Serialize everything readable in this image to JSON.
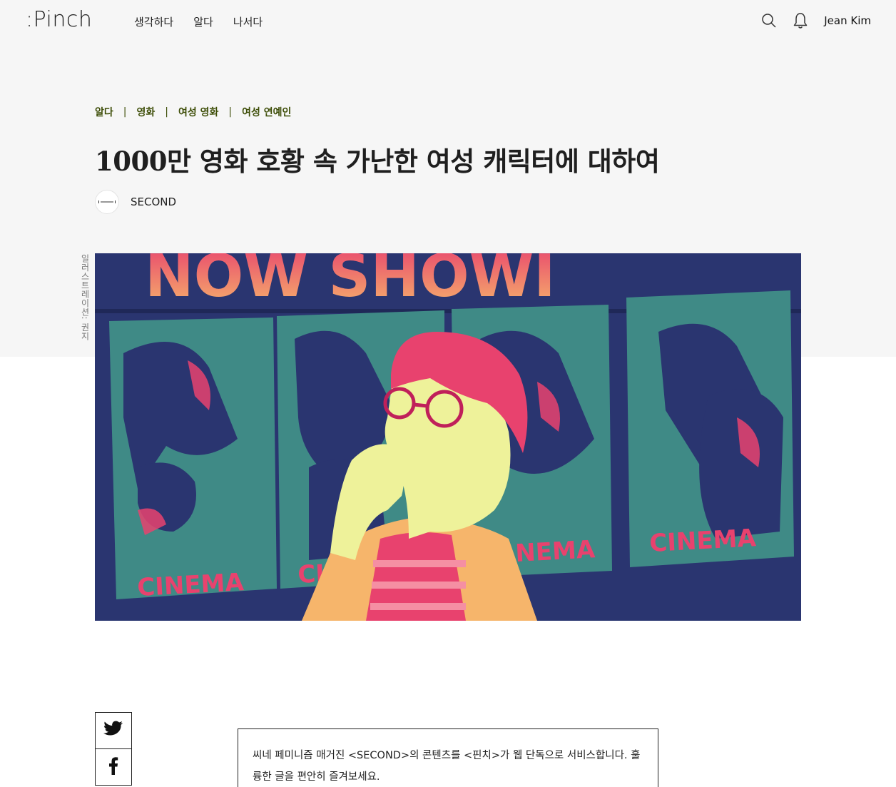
{
  "header": {
    "logo": ":Pinch",
    "nav": [
      "생각하다",
      "알다",
      "나서다"
    ],
    "user_name": "Jean Kim",
    "icons": [
      "search-icon",
      "bell-icon"
    ]
  },
  "breadcrumb": [
    "알다",
    "영화",
    "여성 영화",
    "여성 연예인"
  ],
  "article": {
    "title": "1000만 영화 호황 속 가난한 여성 캐릭터에 대하여",
    "author": "SECOND",
    "image_credit": "일러스트레이션: 권지",
    "hero_texts": {
      "marquee": "NOW SHOWI",
      "panels": [
        "CINEMA",
        "CI",
        "NEMA",
        "CINEMA"
      ]
    },
    "notice": "씨네 페미니즘 매거진 <SECOND>의 콘텐츠를 <핀치>가 웹 단독으로 서비스합니다. 훌륭한 글을 편안히 즐겨보세요."
  },
  "share": [
    "twitter-icon",
    "facebook-icon"
  ],
  "colors": {
    "background_band": "#f6f6f6",
    "breadcrumb": "#3d4d07",
    "hero_navy": "#2a3570",
    "hero_teal": "#3f8a86",
    "hero_pink": "#e8426e",
    "hero_yellow": "#eef29a",
    "hero_orange": "#f6b56b"
  }
}
